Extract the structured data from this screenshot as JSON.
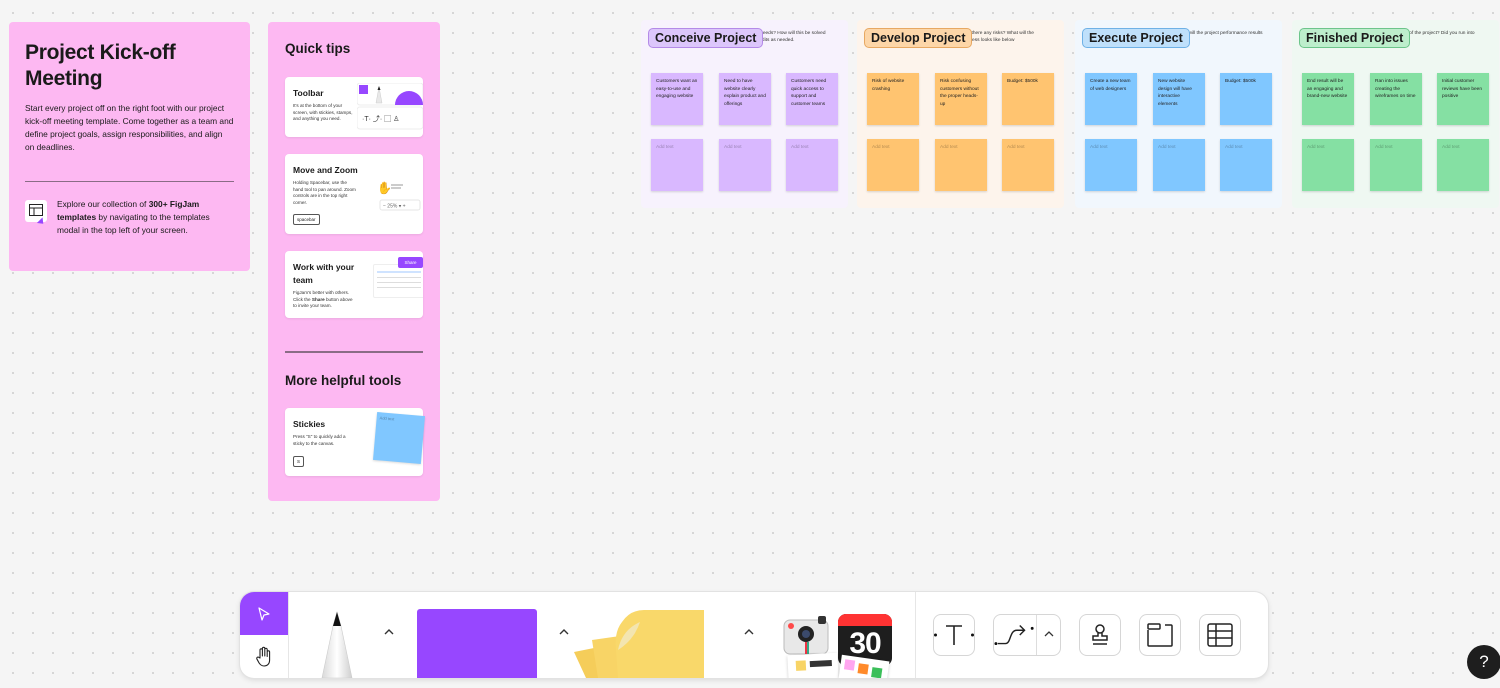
{
  "intro": {
    "title": "Project Kick-off Meeting",
    "body": "Start every project off on the right foot with our project kick-off meeting template. Come together as a team and define project goals, assign responsibilities, and align on deadlines.",
    "explore_prefix": "Explore our collection of ",
    "explore_bold": "300+ FigJam templates",
    "explore_suffix": " by navigating to the templates modal in the top left of your screen."
  },
  "tips": {
    "heading": "Quick tips",
    "cards": [
      {
        "title": "Toolbar",
        "desc": "It's at the bottom of your screen, with stickies, stamps, and anything you need."
      },
      {
        "title": "Move and Zoom",
        "desc": "Holding Spacebar, use the hand tool to pan around. Zoom controls are in the top right corner.",
        "key": "spacebar",
        "zoom": "25%"
      },
      {
        "title": "Work with your team",
        "desc_prefix": "FigJam's better with others. Click the ",
        "desc_bold": "Share",
        "desc_suffix": " button above to invite your team.",
        "share_label": "Share"
      }
    ],
    "heading2": "More helpful tools",
    "stickies": {
      "title": "Stickies",
      "desc": "Press \"S\" to quickly add a sticky to the canvas.",
      "key": "S",
      "sticky_text": "Add text"
    }
  },
  "boards": [
    {
      "label": "Conceive Project",
      "desc": "What is the project vision? Who are the customers' needs? How will this be solved for them? Present the idea to your team and make edits as needed.",
      "colors": {
        "bg": "#f7f2fd",
        "sticky": "#d9b8ff",
        "label_bg": "#dcc6fb",
        "label_border": "#b48ae8"
      },
      "stickies": [
        "Customers want an easy-to-use and engaging website",
        "Need to have website clearly explain product and offerings",
        "Customers need quick access to support and customer teams",
        "Add text",
        "Add text",
        "Add text"
      ]
    },
    {
      "label": "Develop Project",
      "desc": "Think about how to take this idea into action. Are there any risks? What will the budget look like? Describe in detail what this process looks like below",
      "colors": {
        "bg": "#fdf4ec",
        "sticky": "#ffc470",
        "label_bg": "#fdd6a8",
        "label_border": "#e7a862"
      },
      "stickies": [
        "Risk of website crashing",
        "Risk confusing customers without the proper heads-up",
        "Budget: $500k",
        "Add text",
        "Add text",
        "Add text"
      ]
    },
    {
      "label": "Execute Project",
      "desc": "How will the team execute on this project? What will the project performance results look like? Describe this process below.",
      "colors": {
        "bg": "#f1f7fd",
        "sticky": "#80c7ff",
        "label_bg": "#bfe0fb",
        "label_border": "#6fb1e6"
      },
      "stickies": [
        "Create a new team of web designers",
        "New website design will have interactive elements",
        "Budget: $500k",
        "Add text",
        "Add text",
        "Add text"
      ]
    },
    {
      "label": "Finished Project",
      "desc": "How did the project perform? What are the results of the project? Did you run into any issues? Describe below.",
      "colors": {
        "bg": "#eff8f2",
        "sticky": "#85e0a3",
        "label_bg": "#bdeecc",
        "label_border": "#6cc58a"
      },
      "stickies": [
        "End result will be an engaging and brand-new website",
        "Ran into issues creating the wireframes on time",
        "Initial customer reviews have been positive",
        "Add text",
        "Add text",
        "Add text"
      ]
    }
  ],
  "toolbar": {
    "tools": [
      "select",
      "hand",
      "marker",
      "shape",
      "sticky",
      "stickers",
      "text",
      "connector",
      "stamp",
      "section",
      "table"
    ],
    "active_tool": "select",
    "accent": "#9747ff",
    "calendar_number": "30"
  },
  "help": {
    "label": "?"
  }
}
